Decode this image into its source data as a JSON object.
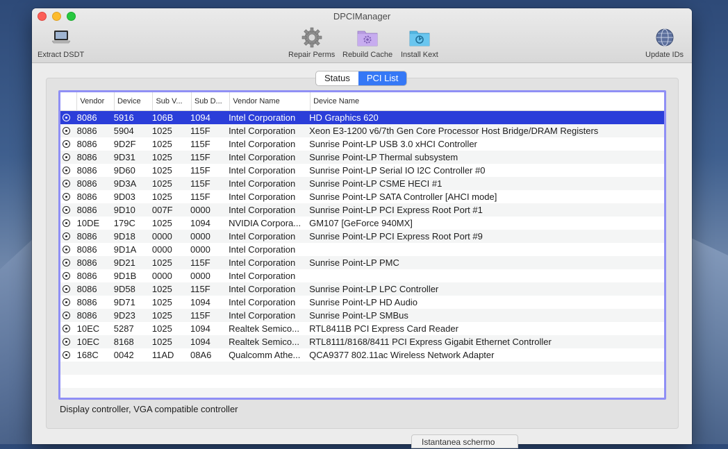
{
  "window": {
    "title": "DPCIManager"
  },
  "toolbar": {
    "extract_label": "Extract DSDT",
    "repair_label": "Repair Perms",
    "rebuild_label": "Rebuild Cache",
    "install_label": "Install Kext",
    "update_label": "Update IDs"
  },
  "tabs": {
    "status": "Status",
    "pci_list": "PCI List",
    "selected": "PCI List"
  },
  "table": {
    "headers": [
      "Vendor",
      "Device",
      "Sub V...",
      "Sub D...",
      "Vendor Name",
      "Device Name"
    ],
    "selected_row": 0,
    "rows": [
      [
        "8086",
        "5916",
        "106B",
        "1094",
        "Intel Corporation",
        "HD Graphics 620"
      ],
      [
        "8086",
        "5904",
        "1025",
        "115F",
        "Intel Corporation",
        "Xeon E3-1200 v6/7th Gen Core Processor Host Bridge/DRAM Registers"
      ],
      [
        "8086",
        "9D2F",
        "1025",
        "115F",
        "Intel Corporation",
        "Sunrise Point-LP USB 3.0 xHCI Controller"
      ],
      [
        "8086",
        "9D31",
        "1025",
        "115F",
        "Intel Corporation",
        "Sunrise Point-LP Thermal subsystem"
      ],
      [
        "8086",
        "9D60",
        "1025",
        "115F",
        "Intel Corporation",
        "Sunrise Point-LP Serial IO I2C Controller #0"
      ],
      [
        "8086",
        "9D3A",
        "1025",
        "115F",
        "Intel Corporation",
        "Sunrise Point-LP CSME HECI #1"
      ],
      [
        "8086",
        "9D03",
        "1025",
        "115F",
        "Intel Corporation",
        "Sunrise Point-LP SATA Controller [AHCI mode]"
      ],
      [
        "8086",
        "9D10",
        "007F",
        "0000",
        "Intel Corporation",
        "Sunrise Point-LP PCI Express Root Port #1"
      ],
      [
        "10DE",
        "179C",
        "1025",
        "1094",
        "NVIDIA Corpora...",
        "GM107 [GeForce 940MX]"
      ],
      [
        "8086",
        "9D18",
        "0000",
        "0000",
        "Intel Corporation",
        "Sunrise Point-LP PCI Express Root Port #9"
      ],
      [
        "8086",
        "9D1A",
        "0000",
        "0000",
        "Intel Corporation",
        ""
      ],
      [
        "8086",
        "9D21",
        "1025",
        "115F",
        "Intel Corporation",
        "Sunrise Point-LP PMC"
      ],
      [
        "8086",
        "9D1B",
        "0000",
        "0000",
        "Intel Corporation",
        ""
      ],
      [
        "8086",
        "9D58",
        "1025",
        "115F",
        "Intel Corporation",
        "Sunrise Point-LP LPC Controller"
      ],
      [
        "8086",
        "9D71",
        "1025",
        "1094",
        "Intel Corporation",
        "Sunrise Point-LP HD Audio"
      ],
      [
        "8086",
        "9D23",
        "1025",
        "115F",
        "Intel Corporation",
        "Sunrise Point-LP SMBus"
      ],
      [
        "10EC",
        "5287",
        "1025",
        "1094",
        "Realtek Semico...",
        "RTL8411B PCI Express Card Reader"
      ],
      [
        "10EC",
        "8168",
        "1025",
        "1094",
        "Realtek Semico...",
        "RTL8111/8168/8411 PCI Express Gigabit Ethernet Controller"
      ],
      [
        "168C",
        "0042",
        "11AD",
        "08A6",
        "Qualcomm Athe...",
        "QCA9377 802.11ac Wireless Network Adapter"
      ]
    ]
  },
  "status_text": "Display controller, VGA compatible controller",
  "tooltip_text": "Istantanea schermo",
  "colors": {
    "selection": "#2b3ed9",
    "tab_active": "#3578f6",
    "table_focus_border": "#8f8ff5"
  },
  "icons": [
    "laptop-icon",
    "gear-icon",
    "folder-gear-icon",
    "folder-install-icon",
    "globe-icon",
    "magnifier-icon"
  ]
}
